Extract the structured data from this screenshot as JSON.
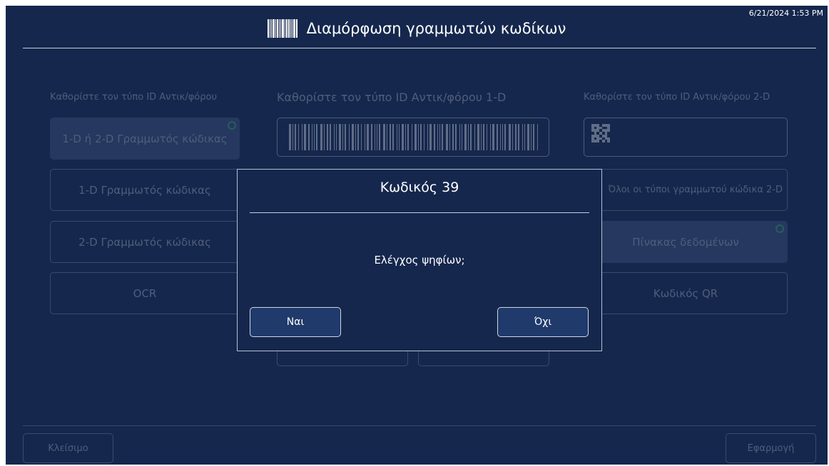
{
  "header": {
    "title": "Διαμόρφωση γραμμωτών κωδίκων",
    "timestamp": "6/21/2024 1:53 PM",
    "icon": "barcode-icon"
  },
  "columns": {
    "type": {
      "title": "Καθορίστε τον τύπο ID Αντικ/φόρου",
      "options": [
        "1-D ή 2-D Γραμμωτός κώδικας",
        "1-D Γραμμωτός κώδικας",
        "2-D Γραμμωτός κώδικας",
        "OCR"
      ]
    },
    "one_d": {
      "title": "Καθορίστε τον τύπο ID Αντικ/φόρου 1-D",
      "preview_icon": "barcode-preview-icon"
    },
    "two_d": {
      "title": "Καθορίστε τον τύπο ID Αντικ/φόρου 2-D",
      "preview_icon": "qr-code-icon",
      "options": [
        "Όλοι οι τύποι γραμμωτού κώδικα 2-D",
        "Πίνακας δεδομένων",
        "Κωδικός QR"
      ]
    }
  },
  "footer": {
    "close_label": "Κλείσιμο",
    "apply_label": "Εφαρμογή"
  },
  "dialog": {
    "title": "Κωδικός 39",
    "question": "Ελέγχος ψηφίων;",
    "yes_label": "Ναι",
    "no_label": "Όχι"
  },
  "colors": {
    "background": "#15274d",
    "selected": "#4a5d85",
    "indicator": "#4fd07a",
    "button": "#1f3a6b"
  }
}
